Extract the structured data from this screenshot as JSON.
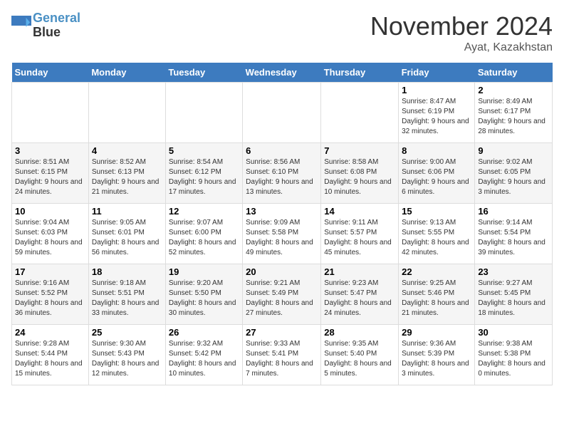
{
  "header": {
    "logo_line1": "General",
    "logo_line2": "Blue",
    "month_title": "November 2024",
    "location": "Ayat, Kazakhstan"
  },
  "days_of_week": [
    "Sunday",
    "Monday",
    "Tuesday",
    "Wednesday",
    "Thursday",
    "Friday",
    "Saturday"
  ],
  "weeks": [
    [
      {
        "day": "",
        "info": ""
      },
      {
        "day": "",
        "info": ""
      },
      {
        "day": "",
        "info": ""
      },
      {
        "day": "",
        "info": ""
      },
      {
        "day": "",
        "info": ""
      },
      {
        "day": "1",
        "info": "Sunrise: 8:47 AM\nSunset: 6:19 PM\nDaylight: 9 hours and 32 minutes."
      },
      {
        "day": "2",
        "info": "Sunrise: 8:49 AM\nSunset: 6:17 PM\nDaylight: 9 hours and 28 minutes."
      }
    ],
    [
      {
        "day": "3",
        "info": "Sunrise: 8:51 AM\nSunset: 6:15 PM\nDaylight: 9 hours and 24 minutes."
      },
      {
        "day": "4",
        "info": "Sunrise: 8:52 AM\nSunset: 6:13 PM\nDaylight: 9 hours and 21 minutes."
      },
      {
        "day": "5",
        "info": "Sunrise: 8:54 AM\nSunset: 6:12 PM\nDaylight: 9 hours and 17 minutes."
      },
      {
        "day": "6",
        "info": "Sunrise: 8:56 AM\nSunset: 6:10 PM\nDaylight: 9 hours and 13 minutes."
      },
      {
        "day": "7",
        "info": "Sunrise: 8:58 AM\nSunset: 6:08 PM\nDaylight: 9 hours and 10 minutes."
      },
      {
        "day": "8",
        "info": "Sunrise: 9:00 AM\nSunset: 6:06 PM\nDaylight: 9 hours and 6 minutes."
      },
      {
        "day": "9",
        "info": "Sunrise: 9:02 AM\nSunset: 6:05 PM\nDaylight: 9 hours and 3 minutes."
      }
    ],
    [
      {
        "day": "10",
        "info": "Sunrise: 9:04 AM\nSunset: 6:03 PM\nDaylight: 8 hours and 59 minutes."
      },
      {
        "day": "11",
        "info": "Sunrise: 9:05 AM\nSunset: 6:01 PM\nDaylight: 8 hours and 56 minutes."
      },
      {
        "day": "12",
        "info": "Sunrise: 9:07 AM\nSunset: 6:00 PM\nDaylight: 8 hours and 52 minutes."
      },
      {
        "day": "13",
        "info": "Sunrise: 9:09 AM\nSunset: 5:58 PM\nDaylight: 8 hours and 49 minutes."
      },
      {
        "day": "14",
        "info": "Sunrise: 9:11 AM\nSunset: 5:57 PM\nDaylight: 8 hours and 45 minutes."
      },
      {
        "day": "15",
        "info": "Sunrise: 9:13 AM\nSunset: 5:55 PM\nDaylight: 8 hours and 42 minutes."
      },
      {
        "day": "16",
        "info": "Sunrise: 9:14 AM\nSunset: 5:54 PM\nDaylight: 8 hours and 39 minutes."
      }
    ],
    [
      {
        "day": "17",
        "info": "Sunrise: 9:16 AM\nSunset: 5:52 PM\nDaylight: 8 hours and 36 minutes."
      },
      {
        "day": "18",
        "info": "Sunrise: 9:18 AM\nSunset: 5:51 PM\nDaylight: 8 hours and 33 minutes."
      },
      {
        "day": "19",
        "info": "Sunrise: 9:20 AM\nSunset: 5:50 PM\nDaylight: 8 hours and 30 minutes."
      },
      {
        "day": "20",
        "info": "Sunrise: 9:21 AM\nSunset: 5:49 PM\nDaylight: 8 hours and 27 minutes."
      },
      {
        "day": "21",
        "info": "Sunrise: 9:23 AM\nSunset: 5:47 PM\nDaylight: 8 hours and 24 minutes."
      },
      {
        "day": "22",
        "info": "Sunrise: 9:25 AM\nSunset: 5:46 PM\nDaylight: 8 hours and 21 minutes."
      },
      {
        "day": "23",
        "info": "Sunrise: 9:27 AM\nSunset: 5:45 PM\nDaylight: 8 hours and 18 minutes."
      }
    ],
    [
      {
        "day": "24",
        "info": "Sunrise: 9:28 AM\nSunset: 5:44 PM\nDaylight: 8 hours and 15 minutes."
      },
      {
        "day": "25",
        "info": "Sunrise: 9:30 AM\nSunset: 5:43 PM\nDaylight: 8 hours and 12 minutes."
      },
      {
        "day": "26",
        "info": "Sunrise: 9:32 AM\nSunset: 5:42 PM\nDaylight: 8 hours and 10 minutes."
      },
      {
        "day": "27",
        "info": "Sunrise: 9:33 AM\nSunset: 5:41 PM\nDaylight: 8 hours and 7 minutes."
      },
      {
        "day": "28",
        "info": "Sunrise: 9:35 AM\nSunset: 5:40 PM\nDaylight: 8 hours and 5 minutes."
      },
      {
        "day": "29",
        "info": "Sunrise: 9:36 AM\nSunset: 5:39 PM\nDaylight: 8 hours and 3 minutes."
      },
      {
        "day": "30",
        "info": "Sunrise: 9:38 AM\nSunset: 5:38 PM\nDaylight: 8 hours and 0 minutes."
      }
    ]
  ]
}
